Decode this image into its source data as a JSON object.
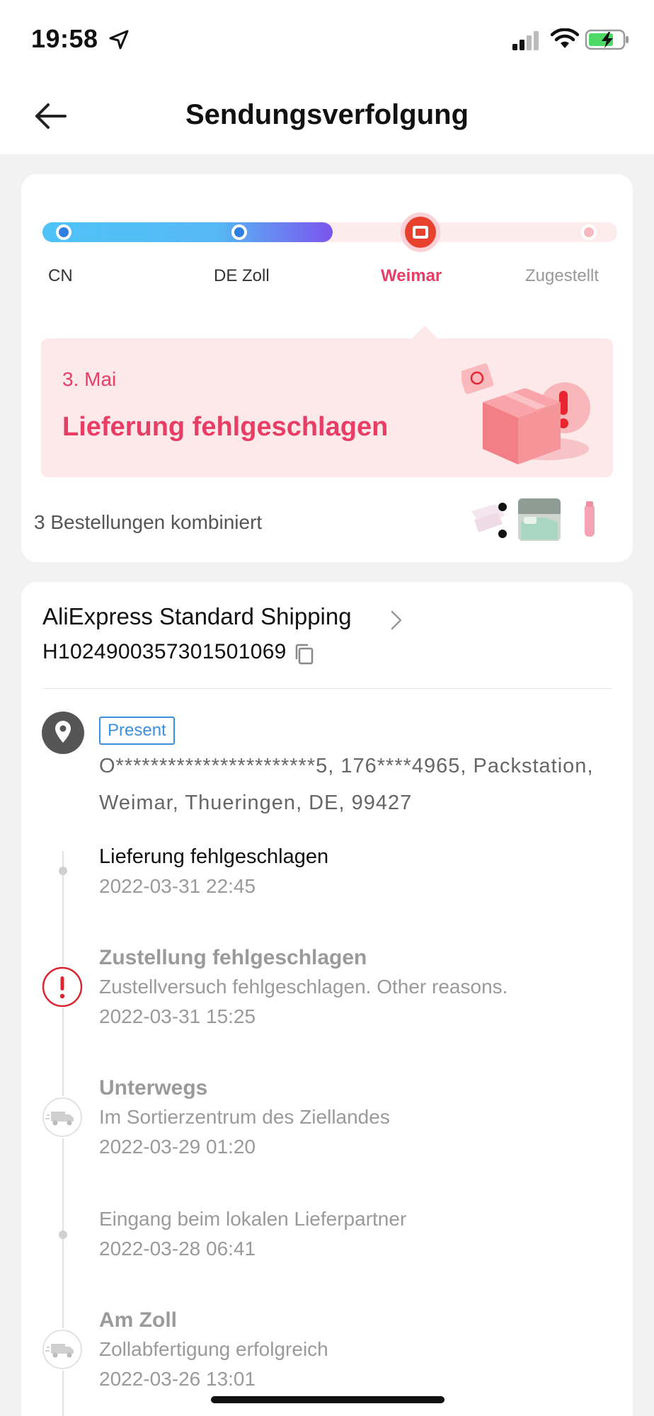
{
  "status_bar": {
    "time": "19:58"
  },
  "header": {
    "title": "Sendungsverfolgung"
  },
  "progress": {
    "steps": [
      {
        "label": "CN",
        "state": "done"
      },
      {
        "label": "DE Zoll",
        "state": "done"
      },
      {
        "label": "Weimar",
        "state": "current"
      },
      {
        "label": "Zugestellt",
        "state": "pending"
      }
    ]
  },
  "status": {
    "date": "3. Mai",
    "text": "Lieferung fehlgeschlagen"
  },
  "orders": {
    "combined_text": "3 Bestellungen kombiniert"
  },
  "shipping": {
    "carrier": "AliExpress Standard Shipping",
    "tracking_number": "H1024900357301501069"
  },
  "address": {
    "badge": "Present",
    "text": "O***********************5, 176****4965, Packstation, Weimar, Thueringen, DE, 99427"
  },
  "events": [
    {
      "title": "Lieferung fehlgeschlagen",
      "desc": "",
      "time": "2022-03-31 22:45"
    },
    {
      "title": "Zustellung fehlgeschlagen",
      "desc": "Zustellversuch fehlgeschlagen. Other reasons.",
      "time": "2022-03-31 15:25"
    },
    {
      "title": "Unterwegs",
      "desc": "Im Sortierzentrum des Ziellandes",
      "time": "2022-03-29 01:20"
    },
    {
      "title": "",
      "desc": "Eingang beim lokalen Lieferpartner",
      "time": "2022-03-28 06:41"
    },
    {
      "title": "Am Zoll",
      "desc": "Zollabfertigung erfolgreich",
      "time": "2022-03-26 13:01"
    }
  ],
  "icons": {
    "location": "location-arrow-icon",
    "back": "back-arrow-icon",
    "chevron": "chevron-right-icon",
    "copy": "copy-icon",
    "pin": "map-pin-icon",
    "alert": "alert-icon",
    "truck": "truck-icon"
  },
  "colors": {
    "accent": "#e83e66",
    "progress_start": "#4fc3f7",
    "progress_end": "#7b68ee",
    "badge_blue": "#3d8fe0"
  }
}
